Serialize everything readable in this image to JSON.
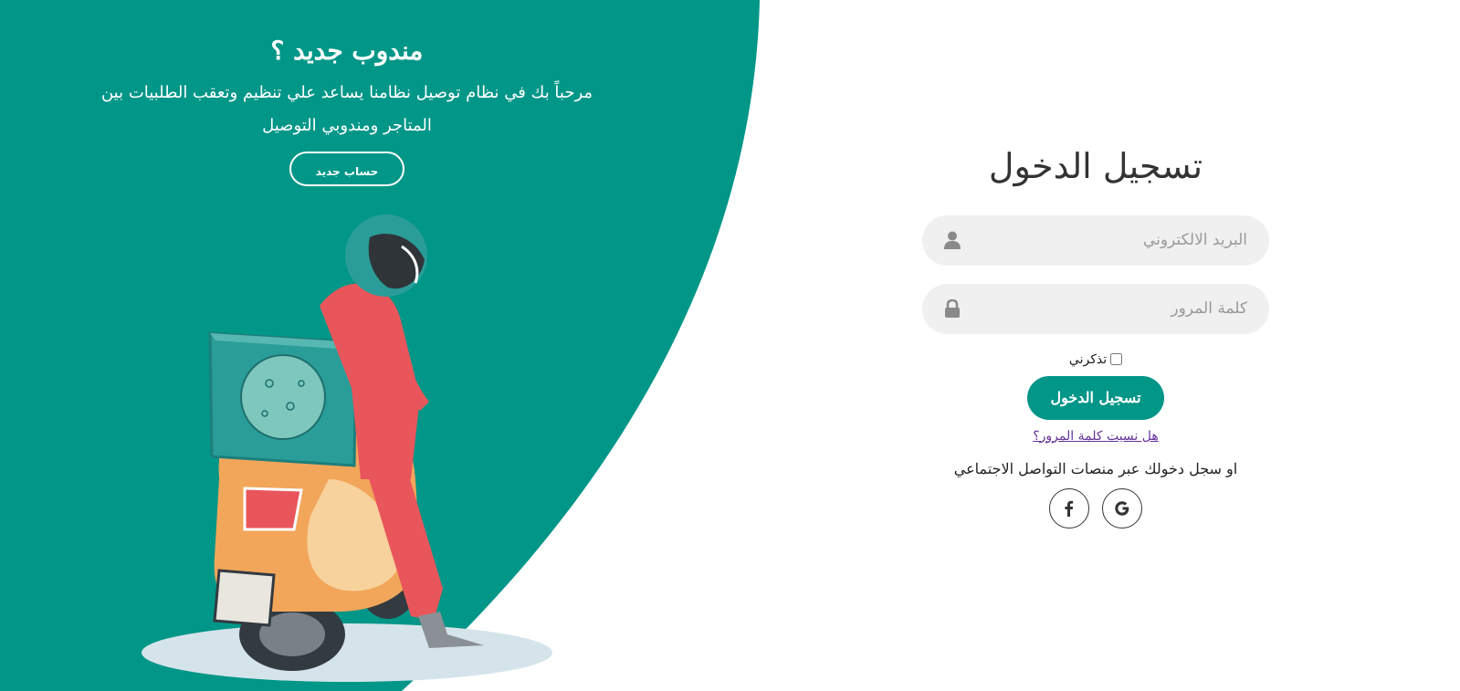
{
  "colors": {
    "primary": "#009688",
    "field_bg": "#f0f0f0",
    "link": "#663399"
  },
  "promo": {
    "title": "مندوب جديد ؟",
    "text": "مرحباً بك في نظام توصيل نظامنا يساعد علي تنظيم وتعقب الطلبيات بين المتاجر ومندوبي التوصيل",
    "button_label": "حساب جديد"
  },
  "login": {
    "title": "تسجيل الدخول",
    "email_placeholder": "البريد الالكتروني",
    "password_placeholder": "كلمة المرور",
    "remember_label": "تذكرني",
    "submit_label": "تسجيل الدخول",
    "forgot_link": "هل نسيت كلمة المرور؟",
    "social_text": "او سجل دخولك عبر منصات التواصل الاجتماعي"
  },
  "icons": {
    "email_field": "user-icon",
    "password_field": "lock-icon",
    "social": [
      "facebook-icon",
      "google-icon"
    ]
  }
}
